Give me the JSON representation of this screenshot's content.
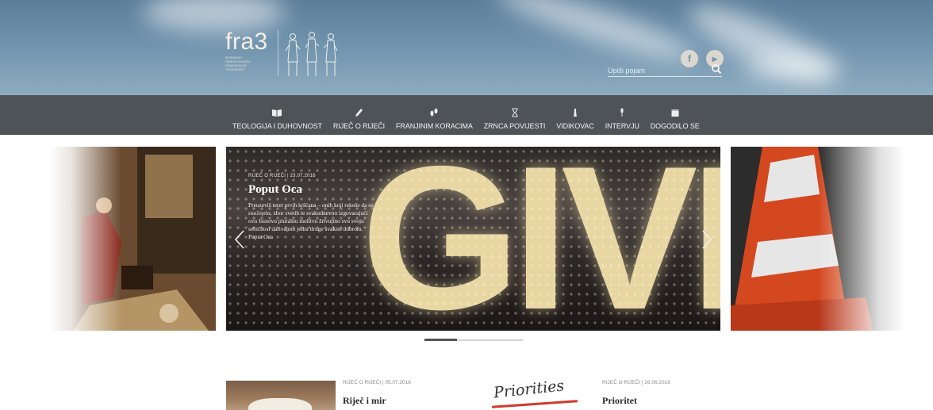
{
  "header": {
    "logo_text": "fra3",
    "logo_subtitle": "BOSONSKI HERCEGOVAČKI FRANJEVAČKI TROMJESEČ",
    "search_placeholder": "Upiši pojam",
    "social": [
      {
        "icon": "facebook-icon",
        "glyph": "f"
      },
      {
        "icon": "youtube-icon",
        "glyph": "▶"
      }
    ]
  },
  "nav": {
    "items": [
      {
        "label": "TEOLOGIJA I DUHOVNOST",
        "icon": "book-icon",
        "glyph": "📖"
      },
      {
        "label": "RIJEČ O RIJEČI",
        "icon": "pen-icon",
        "glyph": "✎"
      },
      {
        "label": "FRANJINIM KORACIMA",
        "icon": "footsteps-icon",
        "glyph": "👣"
      },
      {
        "label": "ZRNCA POVIJESTI",
        "icon": "hourglass-icon",
        "glyph": "⧗"
      },
      {
        "label": "VIDIKOVAC",
        "icon": "lighthouse-icon",
        "glyph": "♜"
      },
      {
        "label": "INTERVJU",
        "icon": "microphone-icon",
        "glyph": "🎤"
      },
      {
        "label": "DOGODILO SE",
        "icon": "calendar-icon",
        "glyph": "▦"
      }
    ]
  },
  "slider": {
    "active": {
      "category": "RIJEČ O RIJEČI",
      "date": "23.07.2016",
      "meta": "RIJEČ O RIJEČI  |  23.07.2016",
      "title": "Poput Oca",
      "text": "Preuzeviš teret prvih kršćana – onih koji rekoše da su εκκλησία, zbor svetih te svakodnevno izgovarajući ovu Isusovu plurálnu molitvu žrtvujmo svu svoju sebičnost darivajmo jedni druge svakim dobrom. Poput Oca",
      "image_word": "GIVE"
    },
    "pager_progress": 0.33
  },
  "articles": [
    {
      "meta": "RIJEČ O RIJEČI  |  05.07.2016",
      "title": "Riječ i mir"
    },
    {
      "meta": "RIJEČ O RIJEČI  |  26.06.2016",
      "title": "Prioritet",
      "image_word": "Priorities"
    }
  ]
}
